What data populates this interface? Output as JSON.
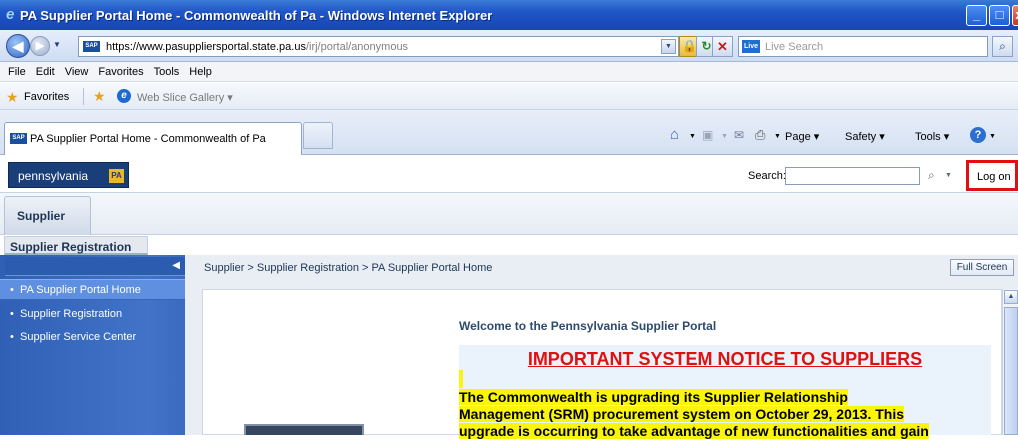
{
  "window": {
    "title": "PA Supplier Portal Home - Commonwealth of Pa - Windows Internet Explorer",
    "min": "_",
    "max": "□",
    "close": "x"
  },
  "address": {
    "url_main": "https://www.pasuppliersportal.state.pa.us",
    "url_path": "/irj/portal/anonymous",
    "live_search_placeholder": "Live Search"
  },
  "menu": [
    "File",
    "Edit",
    "View",
    "Favorites",
    "Tools",
    "Help"
  ],
  "favorites": {
    "label": "Favorites",
    "web_slice": "Web Slice Gallery ▾"
  },
  "tab": {
    "title": "PA Supplier Portal Home - Commonwealth of Pa"
  },
  "commands": {
    "page": "Page ▾",
    "safety": "Safety ▾",
    "tools": "Tools ▾",
    "help": "?"
  },
  "portal": {
    "logo_text": "pennsylvania",
    "logo_badge": "PA",
    "search_label": "Search:",
    "search_value": "",
    "logon": "Log on",
    "level1_tab": "Supplier",
    "level2_tab": "Supplier Registration",
    "nav_items": [
      "PA Supplier Portal Home",
      "Supplier Registration",
      "Supplier Service Center"
    ],
    "breadcrumb": "Supplier  >  Supplier Registration  >  PA Supplier Portal Home",
    "full_screen": "Full Screen"
  },
  "content": {
    "welcome": "Welcome to the Pennsylvania Supplier Portal",
    "notice_title": "IMPORTANT SYSTEM NOTICE TO SUPPLIERS",
    "notice_line1": "The Commonwealth is upgrading its Supplier Relationship",
    "notice_line2": "Management (SRM) procurement system on October 29, 2013. This",
    "notice_line3": "upgrade is occurring to take advantage of new functionalities and gain"
  },
  "colors": {
    "titlebar": "#1f55c7",
    "nav_bg": "#3a6bc0",
    "nav_active": "#5f8fe0",
    "logon_highlight": "#e01010",
    "notice_red": "#e01010",
    "highlight_yellow": "#fbf50a"
  },
  "icons": {
    "ie": "ie-logo-icon",
    "back": "back-arrow-icon",
    "forward": "forward-arrow-icon",
    "lock": "lock-icon",
    "refresh": "refresh-icon",
    "stop": "stop-icon",
    "search": "magnifier-icon",
    "home": "home-icon",
    "feeds": "feeds-icon",
    "mail": "mail-icon",
    "print": "print-icon",
    "help": "help-icon"
  }
}
